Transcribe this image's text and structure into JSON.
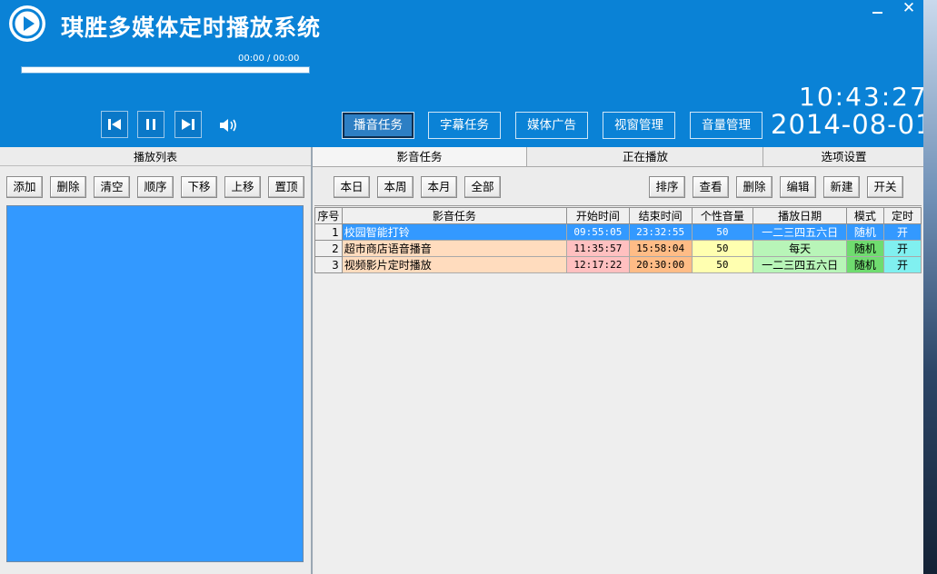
{
  "header": {
    "app_title": "琪胜多媒体定时播放系统",
    "time_display": "00:00 / 00:00",
    "progress": 0,
    "clock": "10:43:27",
    "date": "2014-08-01",
    "minimize": "_",
    "close": "✕",
    "nav_tabs": [
      "播音任务",
      "字幕任务",
      "媒体广告",
      "视窗管理",
      "音量管理"
    ],
    "active_tab": "播音任务"
  },
  "left_panel": {
    "title": "播放列表",
    "buttons": [
      "添加",
      "删除",
      "清空",
      "顺序",
      "下移",
      "上移",
      "置顶"
    ]
  },
  "right_panel": {
    "tabs": [
      "影音任务",
      "正在播放",
      "选项设置"
    ],
    "filter_buttons": [
      "本日",
      "本周",
      "本月",
      "全部"
    ],
    "action_buttons": [
      "排序",
      "查看",
      "删除",
      "编辑",
      "新建",
      "开关"
    ],
    "table": {
      "columns": [
        "序号",
        "影音任务",
        "开始时间",
        "结束时间",
        "个性音量",
        "播放日期",
        "模式",
        "定时"
      ],
      "rows": [
        {
          "idx": "1",
          "name": "校园智能打铃",
          "start": "09:55:05",
          "end": "23:32:55",
          "volume": "50",
          "days": "一二三四五六日",
          "mode": "随机",
          "timer": "开",
          "selected": true
        },
        {
          "idx": "2",
          "name": "超市商店语音播音",
          "start": "11:35:57",
          "end": "15:58:04",
          "volume": "50",
          "days": "每天",
          "mode": "随机",
          "timer": "开",
          "selected": false
        },
        {
          "idx": "3",
          "name": "视频影片定时播放",
          "start": "12:17:22",
          "end": "20:30:00",
          "volume": "50",
          "days": "一二三四五六日",
          "mode": "随机",
          "timer": "开",
          "selected": false
        }
      ]
    }
  },
  "colors": {
    "header_bg": "#0a82d6",
    "playlist_bg": "#3399ff",
    "selected_row": "#3399ff",
    "name_cell": "#ffdcbe",
    "start_cell": "#ffc0c0",
    "end_cell": "#ffbc86",
    "volume_cell": "#ffffb0",
    "days_cell": "#b8f5b8",
    "mode_cell": "#6fdc6f",
    "timer_cell": "#80f0f0"
  },
  "icons": {
    "logo": "play-circle-icon",
    "prev": "skip-previous-icon",
    "pause": "pause-icon",
    "next": "skip-next-icon",
    "volume": "speaker-icon"
  }
}
